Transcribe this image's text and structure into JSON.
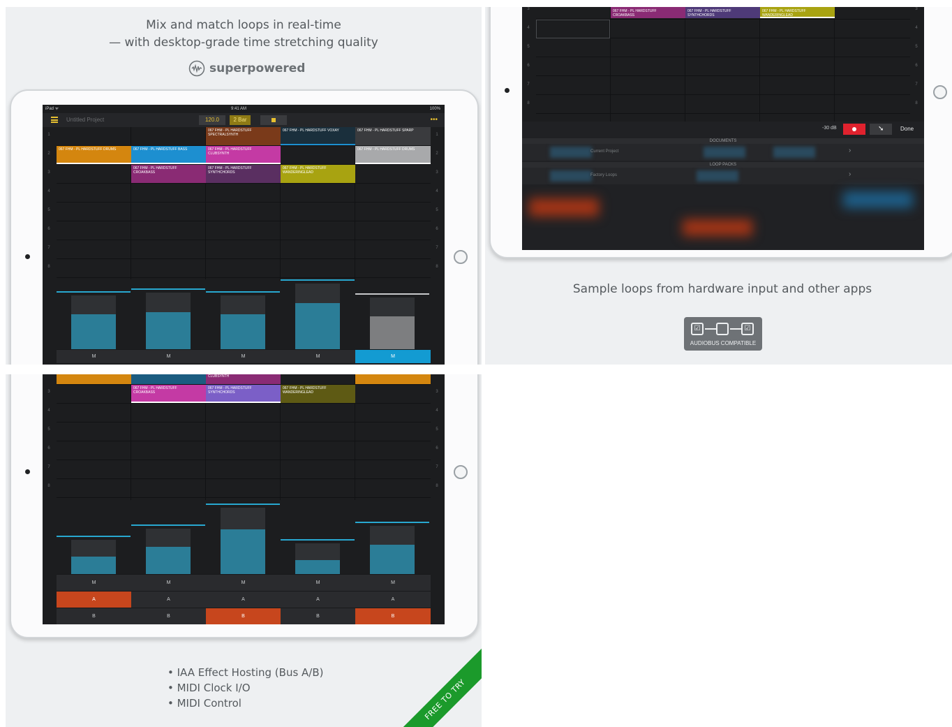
{
  "panel1": {
    "caption_line1": "Mix and match loops in real-time",
    "caption_line2": "— with desktop-grade time stretching quality",
    "brand": "superpowered",
    "brand_icon": "waveform-circle-icon",
    "status_left": "iPad ᯤ",
    "status_time": "9:41 AM",
    "status_battery": "100%",
    "menu_icon": "hamburger-icon",
    "project_title": "Untitled Project",
    "tempo": "120.0",
    "bar_length": "2 Bar",
    "stop_icon": "stop-icon",
    "more_label": "•••",
    "clips": {
      "c1": "067 FHM - PL HARDSTUFF DRUMS",
      "c2": "067 FHM - PL HARDSTUFF BASS",
      "c3a": "067 FHM - PL HARDSTUFF",
      "c3b": "SPECTRALSYNTH",
      "c4": "067 FHM - PL HARDSTUFF VOXAY",
      "c5": "067 FHM - PL HARDSTUFF SPARP",
      "c6a": "067 FHM - PL HARDSTUFF",
      "c6b": "CLUBSYNTH",
      "c7": "067 FHM - PL HARDSTUFF DRUMS",
      "c8a": "067 FHM - PL HARDSTUFF",
      "c8b": "CROAKBASS",
      "c9a": "067 FHM - PL HARDSTUFF",
      "c9b": "SYNTHCHORDS",
      "c10a": "067 FHM - PL HARDSTUFF",
      "c10b": "WANDERINGLEAD"
    },
    "row_numbers": [
      "1",
      "2",
      "3",
      "4",
      "5",
      "6",
      "7",
      "8"
    ],
    "mute_label": "M",
    "fader_levels": [
      0.58,
      0.62,
      0.58,
      0.77,
      0.55
    ]
  },
  "panel2": {
    "clips": {
      "c1a": "067 FHM - PL HARDSTUFF",
      "c1b": "CROAKBASS",
      "c2a": "067 FHM - PL HARDSTUFF",
      "c2b": "SYNTHCHORDS",
      "c3a": "067 FHM - PL HARDSTUFF",
      "c3b": "WANDERINGLEAD"
    },
    "row_numbers": [
      "3",
      "4",
      "5",
      "6",
      "7",
      "8"
    ],
    "db_label": "-30 dB",
    "record_icon": "record-icon",
    "arrow_icon": "arrow-down-icon",
    "done_label": "Done",
    "section_documents": "DOCUMENTS",
    "current_project": "Current Project",
    "section_loop_packs": "LOOP PACKS",
    "factory_loops": "Factory Loops",
    "chevron": "›",
    "caption": "Sample loops from hardware input and other apps",
    "badge_label": "AUDIOBUS COMPATIBLE",
    "badge_check": "☑"
  },
  "panel3": {
    "clips": {
      "c0": "CLUBSYNTH",
      "c1a": "067 FHM - PL HARDSTUFF",
      "c1b": "CROAKBASS",
      "c2a": "067 FHM - PL HARDSTUFF",
      "c2b": "SYNTHCHORDS",
      "c3a": "067 FHM - PL HARDSTUFF",
      "c3b": "WANDERINGLEAD"
    },
    "row_numbers": [
      "3",
      "4",
      "5",
      "6",
      "7",
      "8"
    ],
    "mute_label": "M",
    "a_label": "A",
    "b_label": "B",
    "fader_levels": [
      0.27,
      0.42,
      0.7,
      0.22,
      0.46
    ],
    "bullets": [
      "• IAA Effect Hosting (Bus A/B)",
      "• MIDI Clock I/O",
      "• MIDI Control"
    ],
    "ribbon": "FREE TO TRY"
  },
  "colors": {
    "orange": "#d4860f",
    "blue": "#1d8fd0",
    "magenta": "#c43aa4",
    "purple": "#7b5fc7",
    "olive": "#a8a311",
    "brown": "#7a3a1a",
    "grey": "#a8a9ab",
    "teal": "#2b7d97",
    "green": "#1b9a2b"
  }
}
